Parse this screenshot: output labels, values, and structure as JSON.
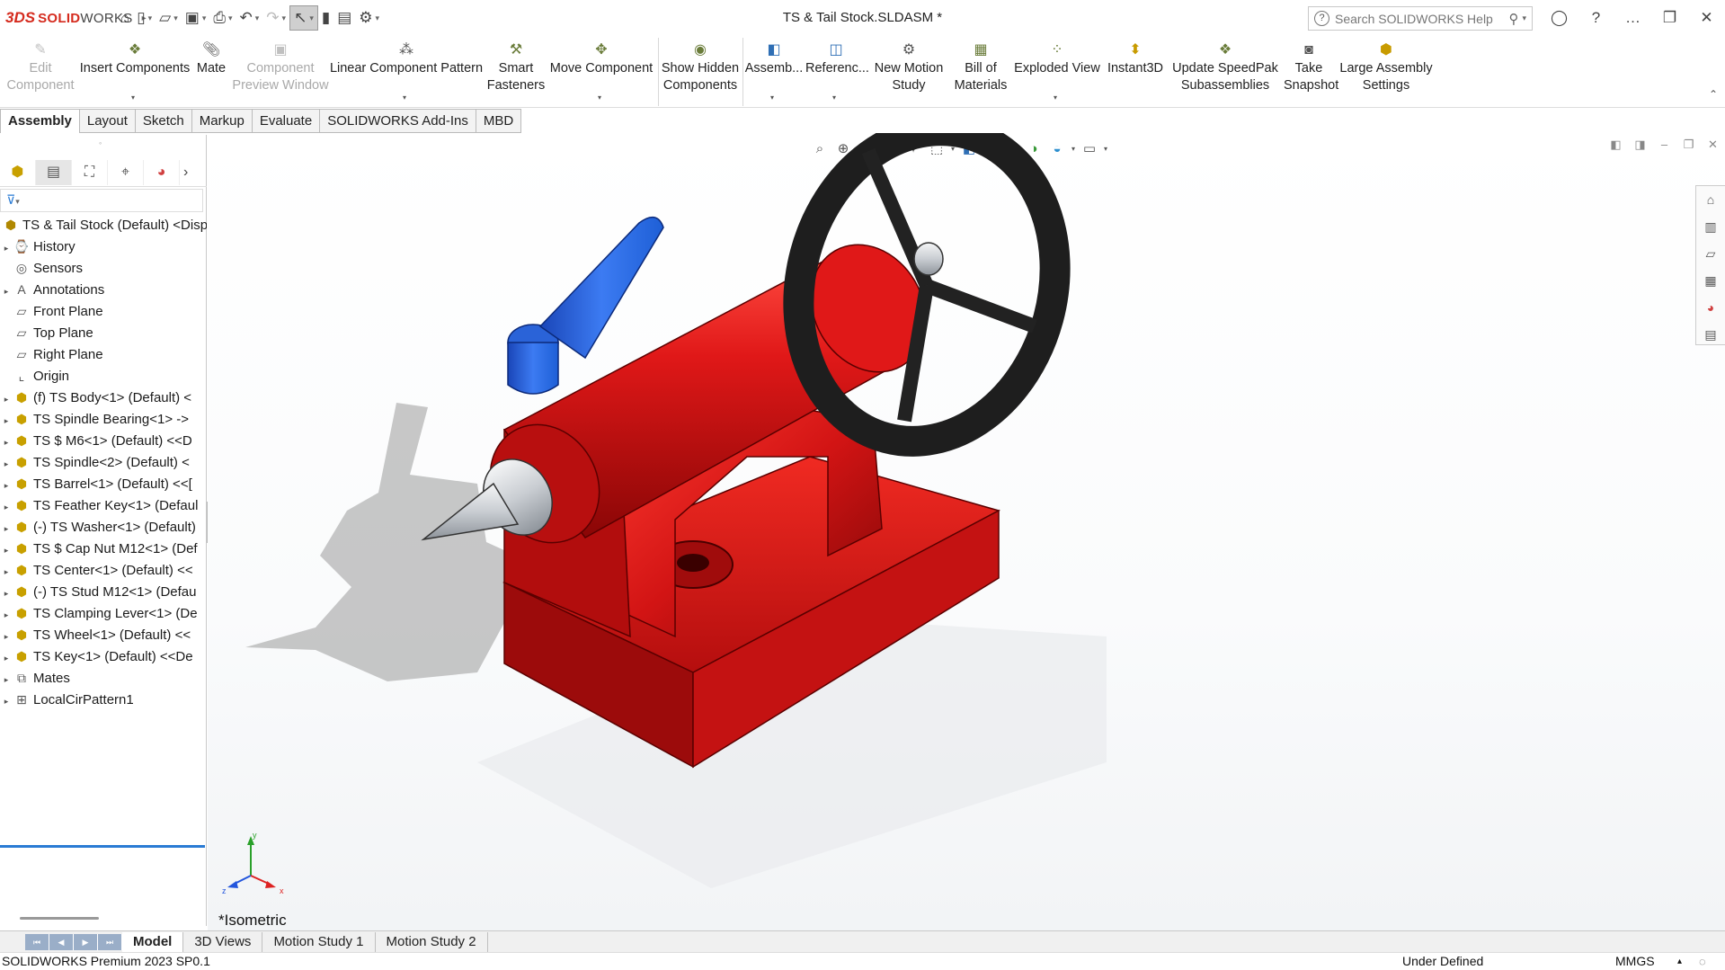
{
  "app": {
    "brand_prefix": "3DS",
    "brand_main": "SOLID",
    "brand_suffix": "WORKS",
    "document_title": "TS & Tail Stock.SLDASM *",
    "search_placeholder": "Search SOLIDWORKS Help"
  },
  "quick_access": [
    {
      "name": "home-icon",
      "glyph": "⌂"
    },
    {
      "name": "new-document-icon",
      "glyph": "🗋"
    },
    {
      "name": "open-icon",
      "glyph": "📂"
    },
    {
      "name": "save-icon",
      "glyph": "💾"
    },
    {
      "name": "print-icon",
      "glyph": "🖶"
    },
    {
      "name": "undo-icon",
      "glyph": "↶"
    },
    {
      "name": "redo-icon",
      "glyph": "↷"
    },
    {
      "name": "select-icon",
      "glyph": "↖"
    },
    {
      "name": "rebuild-icon",
      "glyph": "▮"
    },
    {
      "name": "file-properties-icon",
      "glyph": "▤"
    },
    {
      "name": "options-gear-icon",
      "glyph": "⚙"
    }
  ],
  "ribbon": {
    "edit_component": "Edit\nComponent",
    "insert_components": "Insert Components",
    "mate": "Mate",
    "component_preview": "Component\nPreview Window",
    "linear_pattern": "Linear Component Pattern",
    "smart_fasteners": "Smart\nFasteners",
    "move_component": "Move Component",
    "show_hidden": "Show Hidden\nComponents",
    "assembly": "Assemb...",
    "reference": "Referenc...",
    "new_motion_study": "New Motion\nStudy",
    "bill_of_materials": "Bill of\nMaterials",
    "exploded_view": "Exploded View",
    "instant3d": "Instant3D",
    "update_speedpak": "Update SpeedPak\nSubassemblies",
    "take_snapshot": "Take\nSnapshot",
    "large_assembly": "Large Assembly\nSettings"
  },
  "tabs": [
    "Assembly",
    "Layout",
    "Sketch",
    "Markup",
    "Evaluate",
    "SOLIDWORKS Add-Ins",
    "MBD"
  ],
  "tree": {
    "root": "TS & Tail Stock (Default) <Disp",
    "items": [
      {
        "label": "History",
        "exp": "▸",
        "icon": "history-icon",
        "glyph": "⌚"
      },
      {
        "label": "Sensors",
        "exp": "",
        "icon": "sensors-icon",
        "glyph": "◎"
      },
      {
        "label": "Annotations",
        "exp": "▸",
        "icon": "annotations-icon",
        "glyph": "A"
      },
      {
        "label": "Front Plane",
        "exp": "",
        "icon": "plane-icon",
        "glyph": "▱"
      },
      {
        "label": "Top Plane",
        "exp": "",
        "icon": "plane-icon",
        "glyph": "▱"
      },
      {
        "label": "Right Plane",
        "exp": "",
        "icon": "plane-icon",
        "glyph": "▱"
      },
      {
        "label": "Origin",
        "exp": "",
        "icon": "origin-icon",
        "glyph": "⌞"
      },
      {
        "label": "(f) TS Body<1> (Default) <",
        "exp": "▸",
        "icon": "part-icon",
        "glyph": "⬢"
      },
      {
        "label": "TS Spindle Bearing<1> ->",
        "exp": "▸",
        "icon": "part-icon",
        "glyph": "⬢"
      },
      {
        "label": "TS $ M6<1> (Default) <<D",
        "exp": "▸",
        "icon": "part-icon",
        "glyph": "⬢"
      },
      {
        "label": "TS Spindle<2> (Default) <",
        "exp": "▸",
        "icon": "part-icon",
        "glyph": "⬢"
      },
      {
        "label": "TS Barrel<1> (Default) <<[",
        "exp": "▸",
        "icon": "part-icon",
        "glyph": "⬢"
      },
      {
        "label": "TS Feather Key<1> (Defaul",
        "exp": "▸",
        "icon": "part-icon",
        "glyph": "⬢"
      },
      {
        "label": "(-) TS Washer<1> (Default)",
        "exp": "▸",
        "icon": "part-icon",
        "glyph": "⬢"
      },
      {
        "label": "TS $ Cap Nut M12<1> (Def",
        "exp": "▸",
        "icon": "part-icon",
        "glyph": "⬢"
      },
      {
        "label": "TS Center<1> (Default) <<",
        "exp": "▸",
        "icon": "part-icon",
        "glyph": "⬢"
      },
      {
        "label": "(-) TS Stud M12<1> (Defau",
        "exp": "▸",
        "icon": "part-icon",
        "glyph": "⬢"
      },
      {
        "label": "TS Clamping Lever<1> (De",
        "exp": "▸",
        "icon": "part-icon",
        "glyph": "⬢"
      },
      {
        "label": "TS Wheel<1> (Default) <<",
        "exp": "▸",
        "icon": "part-icon",
        "glyph": "⬢"
      },
      {
        "label": "TS Key<1> (Default) <<De",
        "exp": "▸",
        "icon": "part-icon",
        "glyph": "⬢"
      },
      {
        "label": "Mates",
        "exp": "▸",
        "icon": "mates-icon",
        "glyph": "⧉"
      },
      {
        "label": "LocalCirPattern1",
        "exp": "▸",
        "icon": "pattern-icon",
        "glyph": "⊞"
      }
    ]
  },
  "viewport": {
    "view_name": "*Isometric",
    "triad": {
      "x": "x",
      "y": "y",
      "z": "z"
    },
    "colors": {
      "body": "#d21414",
      "handwheel": "#1e1e1e",
      "lever": "#1e5fd6",
      "center": "#c9cdd2"
    }
  },
  "bottom_tabs": [
    "Model",
    "3D Views",
    "Motion Study 1",
    "Motion Study 2"
  ],
  "status": {
    "version": "SOLIDWORKS Premium 2023 SP0.1",
    "state": "Under Defined",
    "units": "MMGS",
    "units_arrow": "▴"
  }
}
